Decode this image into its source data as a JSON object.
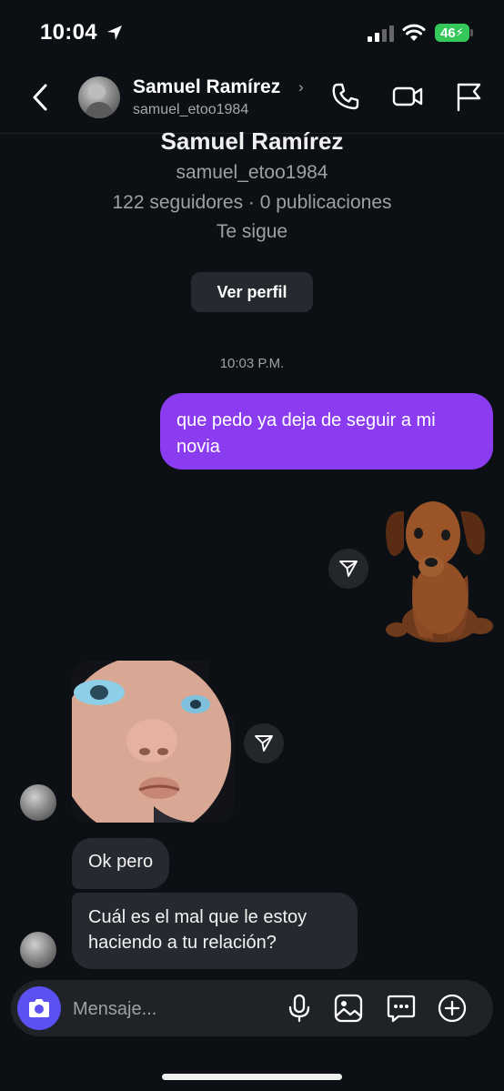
{
  "status_bar": {
    "time": "10:04",
    "battery": "46"
  },
  "header": {
    "name": "Samuel Ramírez",
    "username": "samuel_etoo1984"
  },
  "profile": {
    "name": "Samuel Ramírez",
    "username": "samuel_etoo1984",
    "stats": "122 seguidores · 0 publicaciones",
    "follow_status": "Te sigue",
    "view_profile": "Ver perfil"
  },
  "timestamp": "10:03 P.M.",
  "messages": {
    "outgoing_1_line1": "que pedo ya deja de seguir a mi",
    "outgoing_1_line2": "novia",
    "incoming_1": "Ok pero",
    "incoming_2_line1": "Cuál es el mal que le estoy",
    "incoming_2_line2": "haciendo a tu relación?"
  },
  "composer": {
    "placeholder": "Mensaje..."
  },
  "colors": {
    "accent": "#8b3cf0",
    "camera": "#5b51f2",
    "background": "#0c1014",
    "bubble_in": "#262a30",
    "battery": "#34c759"
  }
}
